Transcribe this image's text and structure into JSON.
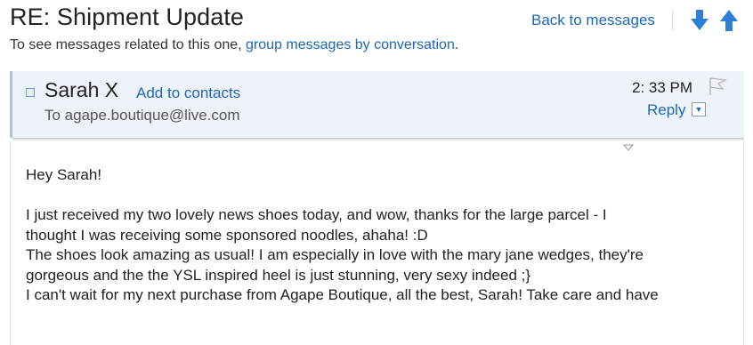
{
  "message": {
    "subject": "RE: Shipment Update",
    "conversation_note_prefix": "To see messages related to this one, ",
    "conversation_link": "group messages by conversation",
    "conversation_note_suffix": ".",
    "back_link": "Back to messages",
    "sender": {
      "name": "Sarah X",
      "add_contacts": "Add to contacts",
      "to_line": "To agape.boutique@live.com"
    },
    "time": "2: 33 PM",
    "reply_label": "Reply",
    "body": {
      "greeting": "Hey Sarah!",
      "lines": [
        "I just received my two lovely news shoes today, and wow, thanks for the large parcel - I",
        "thought I was receiving some sponsored noodles, ahaha! :D",
        "The shoes look amazing as usual! I am especially in love with the mary jane wedges, they're",
        "gorgeous and the the YSL inspired heel is just stunning, very sexy indeed ;}",
        "I can't wait for my next purchase from Agape Boutique, all the best, Sarah! Take care and have"
      ]
    }
  },
  "icons": {
    "next": "arrow-down-icon",
    "prev": "arrow-up-icon",
    "flag": "flag-icon",
    "reply_menu": "chevron-down-icon",
    "expand": "triangle-down-icon"
  },
  "colors": {
    "link": "#1d66b8",
    "nav_arrow": "#2f7fd8",
    "header_bg": "#eef3fa",
    "header_border": "#a9c4e6"
  }
}
